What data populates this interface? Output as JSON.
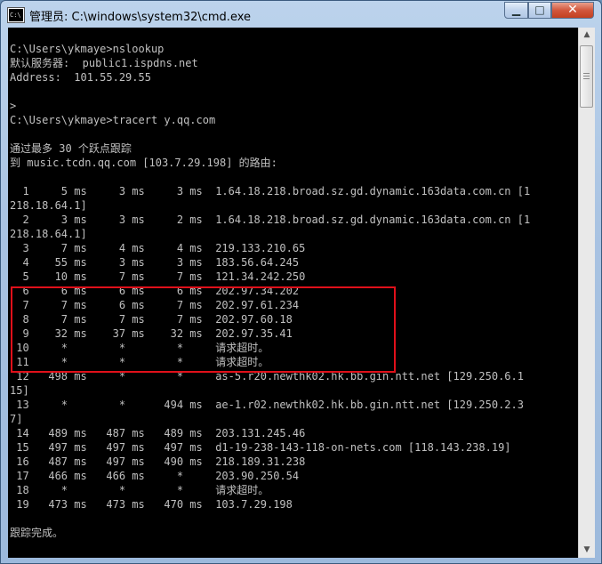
{
  "window": {
    "title": "管理员: C:\\windows\\system32\\cmd.exe",
    "app_icon": "cmd-icon",
    "controls": {
      "minimize": "minimize-icon",
      "maximize": "maximize-icon",
      "close": "close-icon"
    }
  },
  "colors": {
    "console_bg": "#000000",
    "console_fg": "#c0c0c0",
    "highlight": "#e0101a"
  },
  "console_lines": [
    "",
    "C:\\Users\\ykmaye>nslookup",
    "默认服务器:  public1.ispdns.net",
    "Address:  101.55.29.55",
    "",
    ">",
    "C:\\Users\\ykmaye>tracert y.qq.com",
    "",
    "通过最多 30 个跃点跟踪",
    "到 music.tcdn.qq.com [103.7.29.198] 的路由:",
    "",
    "  1     5 ms     3 ms     3 ms  1.64.18.218.broad.sz.gd.dynamic.163data.com.cn [1",
    "218.18.64.1]",
    "  2     3 ms     3 ms     2 ms  1.64.18.218.broad.sz.gd.dynamic.163data.com.cn [1",
    "218.18.64.1]",
    "  3     7 ms     4 ms     4 ms  219.133.210.65",
    "  4    55 ms     3 ms     3 ms  183.56.64.245",
    "  5    10 ms     7 ms     7 ms  121.34.242.250",
    "  6     6 ms     6 ms     6 ms  202.97.34.202",
    "  7     7 ms     6 ms     7 ms  202.97.61.234",
    "  8     7 ms     7 ms     7 ms  202.97.60.18",
    "  9    32 ms    37 ms    32 ms  202.97.35.41",
    " 10     *        *        *     请求超时。",
    " 11     *        *        *     请求超时。",
    " 12   498 ms     *        *     as-5.r20.newthk02.hk.bb.gin.ntt.net [129.250.6.1",
    "15]",
    " 13     *        *      494 ms  ae-1.r02.newthk02.hk.bb.gin.ntt.net [129.250.2.3",
    "7]",
    " 14   489 ms   487 ms   489 ms  203.131.245.46",
    " 15   497 ms   497 ms   497 ms  d1-19-238-143-118-on-nets.com [118.143.238.19]",
    " 16   487 ms   497 ms   490 ms  218.189.31.238",
    " 17   466 ms   466 ms     *     203.90.250.54",
    " 18     *        *        *     请求超时。",
    " 19   473 ms   473 ms   470 ms  103.7.29.198",
    "",
    "跟踪完成。",
    ""
  ],
  "scrollbar": {
    "up": "scroll-up-arrow-icon",
    "down": "scroll-down-arrow-icon"
  }
}
